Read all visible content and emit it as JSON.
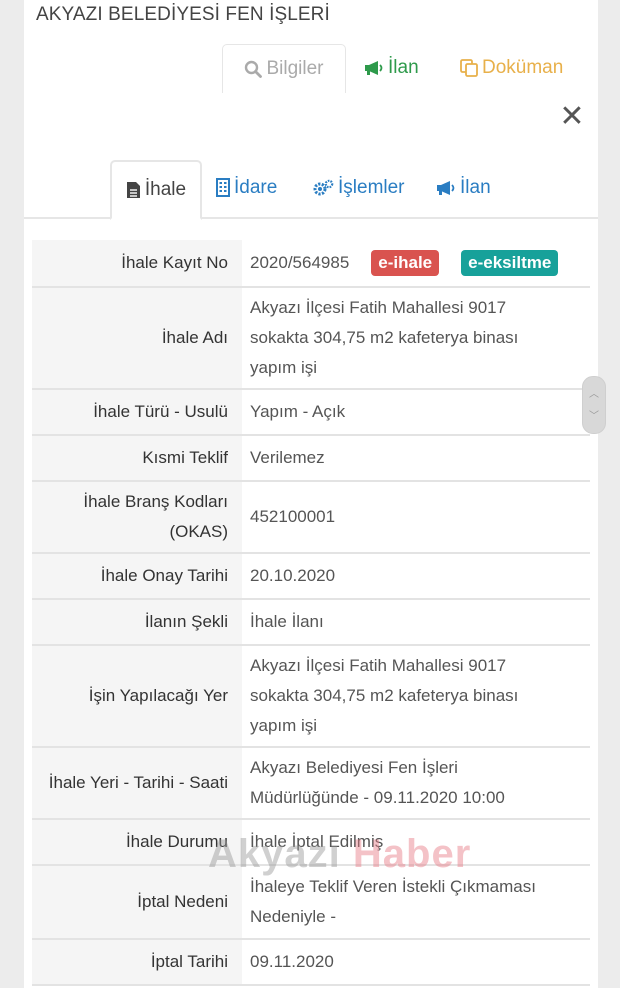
{
  "header": {
    "org_title": "AKYAZI BELEDİYESİ FEN İŞLERİ"
  },
  "top_tabs": [
    {
      "label": "Bilgiler",
      "icon": "search-icon",
      "active": true
    },
    {
      "label": "İlan",
      "icon": "megaphone-icon",
      "active": false,
      "color": "#2e9a4b"
    },
    {
      "label": "Doküman",
      "icon": "copy-icon",
      "active": false,
      "color": "#e8b04a"
    }
  ],
  "sub_tabs": [
    {
      "label": "İhale",
      "icon": "file-icon",
      "active": true
    },
    {
      "label": "İdare",
      "icon": "building-icon",
      "active": false
    },
    {
      "label": "İşlemler",
      "icon": "cogs-icon",
      "active": false
    },
    {
      "label": "İlan",
      "icon": "megaphone-icon",
      "active": false
    }
  ],
  "badges": {
    "e_ihale": "e-ihale",
    "e_eksiltme": "e-eksiltme",
    "e_ihale_color": "#d9534f",
    "e_eksiltme_color": "#17a19a"
  },
  "details": {
    "kayit_no": {
      "label": "İhale Kayıt No",
      "value": "2020/564985"
    },
    "adi": {
      "label": "İhale Adı",
      "lines": [
        "Akyazı İlçesi Fatih Mahallesi 9017",
        "sokakta 304,75 m2 kafeterya binası",
        "yapım işi"
      ]
    },
    "turu": {
      "label": "İhale Türü - Usulü",
      "value": "Yapım - Açık"
    },
    "kismi": {
      "label": "Kısmi Teklif",
      "value": "Verilemez"
    },
    "brans": {
      "label_lines": [
        "İhale Branş Kodları",
        "(OKAS)"
      ],
      "value": "452100001"
    },
    "onay": {
      "label": "İhale Onay Tarihi",
      "value": "20.10.2020"
    },
    "sekli": {
      "label": "İlanın Şekli",
      "value": "İhale İlanı"
    },
    "yer": {
      "label": "İşin Yapılacağı Yer",
      "lines": [
        "Akyazı İlçesi Fatih Mahallesi 9017",
        "sokakta 304,75 m2 kafeterya binası",
        "yapım işi"
      ]
    },
    "yer_tarih": {
      "label": "İhale Yeri - Tarihi - Saati",
      "lines": [
        "Akyazı Belediyesi Fen İşleri",
        "Müdürlüğünde - 09.11.2020 10:00"
      ]
    },
    "durum": {
      "label": "İhale Durumu",
      "value": "İhale İptal Edilmiş"
    },
    "iptal_nedeni": {
      "label": "İptal Nedeni",
      "lines": [
        "İhaleye Teklif Veren İstekli Çıkmaması",
        "Nedeniyle -"
      ]
    },
    "iptal_tarihi": {
      "label": "İptal Tarihi",
      "value": "09.11.2020"
    }
  },
  "watermark": {
    "part1": "Akyazı",
    "part2": "Haber"
  }
}
